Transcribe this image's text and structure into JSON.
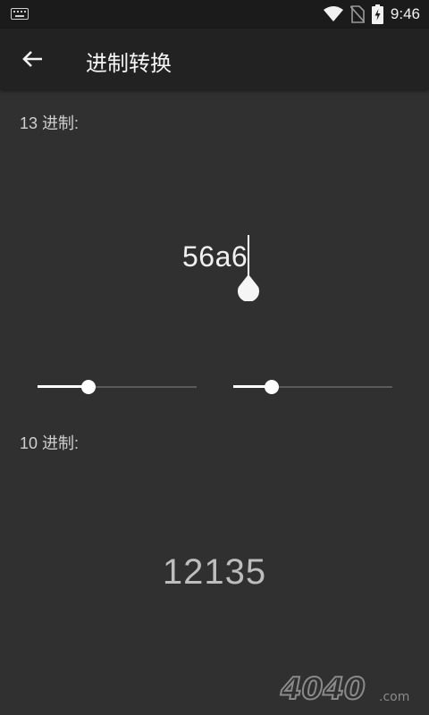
{
  "status_bar": {
    "time": "9:46",
    "icons": [
      "keyboard-icon",
      "wifi-icon",
      "no-sim-icon",
      "battery-charging-icon"
    ]
  },
  "app_bar": {
    "back_icon": "arrow-left-icon",
    "title": "进制转换"
  },
  "source": {
    "label": "13 进制:",
    "value": "56a6"
  },
  "sliders": [
    {
      "name": "source-base-slider",
      "value_fraction": 0.32
    },
    {
      "name": "target-base-slider",
      "value_fraction": 0.24
    }
  ],
  "target": {
    "label": "10 进制:",
    "value": "12135"
  },
  "watermark": {
    "text": "4040",
    "suffix": ".com"
  },
  "colors": {
    "background": "#303030",
    "app_bar": "#222222",
    "status_bar": "#1b1b1b",
    "accent": "#ffffff"
  }
}
